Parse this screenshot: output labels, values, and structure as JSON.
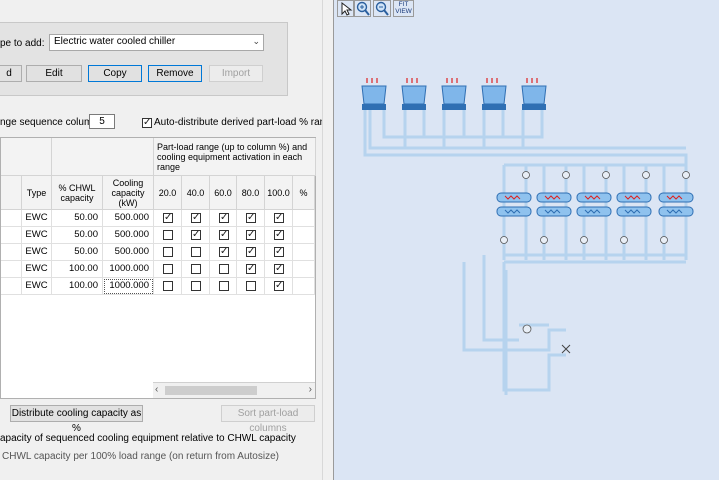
{
  "equipment_panel": {
    "type_label": "pe to add:",
    "type_value": "Electric water cooled chiller",
    "buttons": {
      "add": "d",
      "edit": "Edit",
      "copy": "Copy",
      "remove": "Remove",
      "import": "Import"
    }
  },
  "sequence": {
    "columns_label": "nge sequence columns:",
    "columns_value": "5",
    "auto_distribute_label": "Auto-distribute derived part-load % ranges",
    "auto_distribute_checked": true
  },
  "table": {
    "part_load_header": "Part-load range (up to column %) and cooling equipment activation in each range",
    "col_type": "Type",
    "col_pct_chwl": "% CHWL capacity",
    "col_cooling_capacity": "Cooling capacity (kW)",
    "range_columns": [
      "20.0",
      "40.0",
      "60.0",
      "80.0",
      "100.0",
      "%"
    ],
    "rows": [
      {
        "type": "EWC",
        "pct": "50.00",
        "capacity": "500.000",
        "checks": [
          true,
          true,
          true,
          true,
          true
        ]
      },
      {
        "type": "EWC",
        "pct": "50.00",
        "capacity": "500.000",
        "checks": [
          false,
          true,
          true,
          true,
          true
        ]
      },
      {
        "type": "EWC",
        "pct": "50.00",
        "capacity": "500.000",
        "checks": [
          false,
          false,
          true,
          true,
          true
        ]
      },
      {
        "type": "EWC",
        "pct": "100.00",
        "capacity": "1000.000",
        "checks": [
          false,
          false,
          false,
          true,
          true
        ]
      },
      {
        "type": "EWC",
        "pct": "100.00",
        "capacity": "1000.000",
        "checks": [
          false,
          false,
          false,
          false,
          true
        ]
      }
    ]
  },
  "actions": {
    "distribute": "Distribute cooling capacity as %",
    "sort": "Sort part-load columns"
  },
  "notes": {
    "line1": "apacity of sequenced cooling equipment relative to CHWL capacity",
    "line2": "CHWL capacity per 100% load range (on return from Autosize)"
  },
  "toolbar": {
    "fit_view": "FIT VIEW"
  },
  "colors": {
    "canvas_bg": "#dbe5f4",
    "pipe": "#b6d3ee",
    "accent": "#0078d7"
  }
}
